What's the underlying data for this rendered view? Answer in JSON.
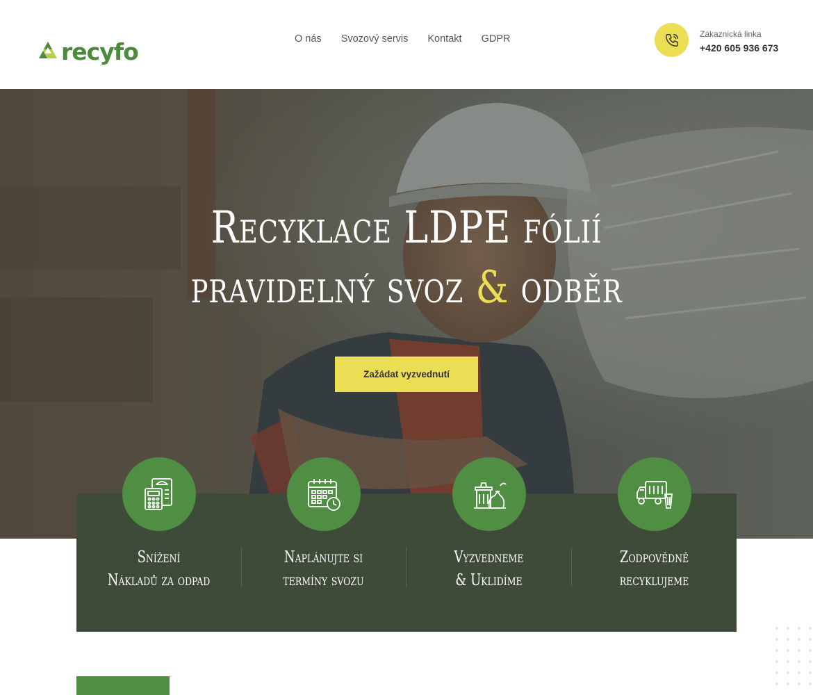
{
  "brand": {
    "name": "recyfo",
    "color": "#4c8a3c",
    "accent": "#ebde55"
  },
  "nav": {
    "items": [
      "O nás",
      "Svozový servis",
      "Kontakt",
      "GDPR"
    ]
  },
  "contact": {
    "icon": "phone-icon",
    "label": "Zákaznická linka",
    "number": "+420 605 936 673"
  },
  "hero": {
    "line1": "Recyklace LDPE fólií",
    "line2_before": "pravidelný svoz ",
    "line2_amp": "&",
    "line2_after": " odběr",
    "cta": "Zažádat vyzvednutí"
  },
  "features": [
    {
      "icon": "calculator-document-icon",
      "line1": "Snížení",
      "line2": "Nákladů za odpad"
    },
    {
      "icon": "calendar-clock-icon",
      "line1": "Naplánujte si",
      "line2": "termíny svozu"
    },
    {
      "icon": "trash-bags-icon",
      "line1": "Vyzvedneme",
      "line2": "& Uklidíme"
    },
    {
      "icon": "garbage-truck-icon",
      "line1": "Zodpovědně",
      "line2": "recyklujeme"
    }
  ]
}
